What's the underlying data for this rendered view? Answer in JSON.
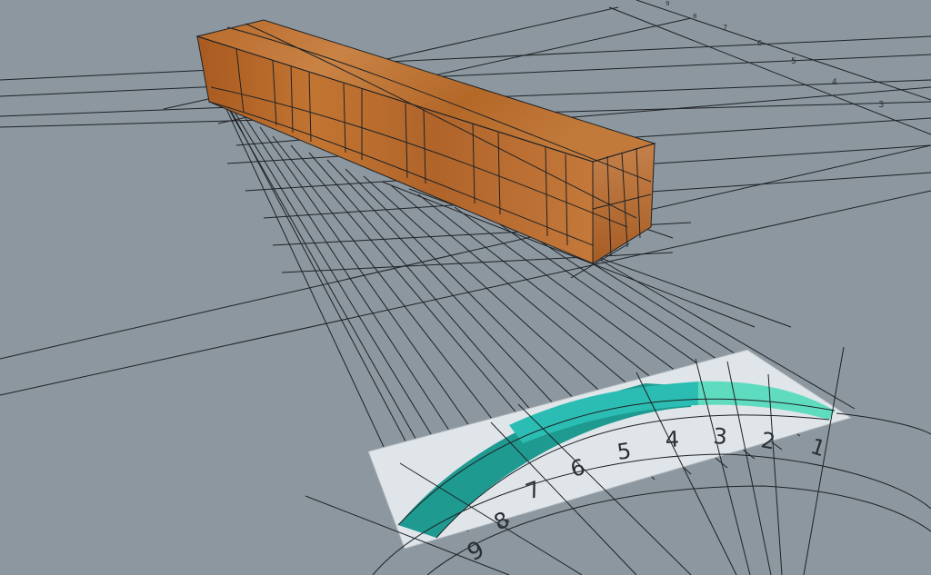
{
  "scene": {
    "background": "#8c979f",
    "line_color": "#1e2226",
    "wood_light": "#c97a3b",
    "wood_dark": "#8e4c1c",
    "panel_color": "#dfe5e9",
    "band_dark": "#1f9a91",
    "band_mid": "#2bbdb3",
    "band_light": "#5fdcc0"
  },
  "curved_ruler_labels": [
    "9",
    "8",
    "7",
    "6",
    "5",
    "4",
    "3",
    "2",
    "1"
  ],
  "far_ruler_labels": [
    "9",
    "8",
    "7",
    "6",
    "5",
    "4",
    "3"
  ]
}
